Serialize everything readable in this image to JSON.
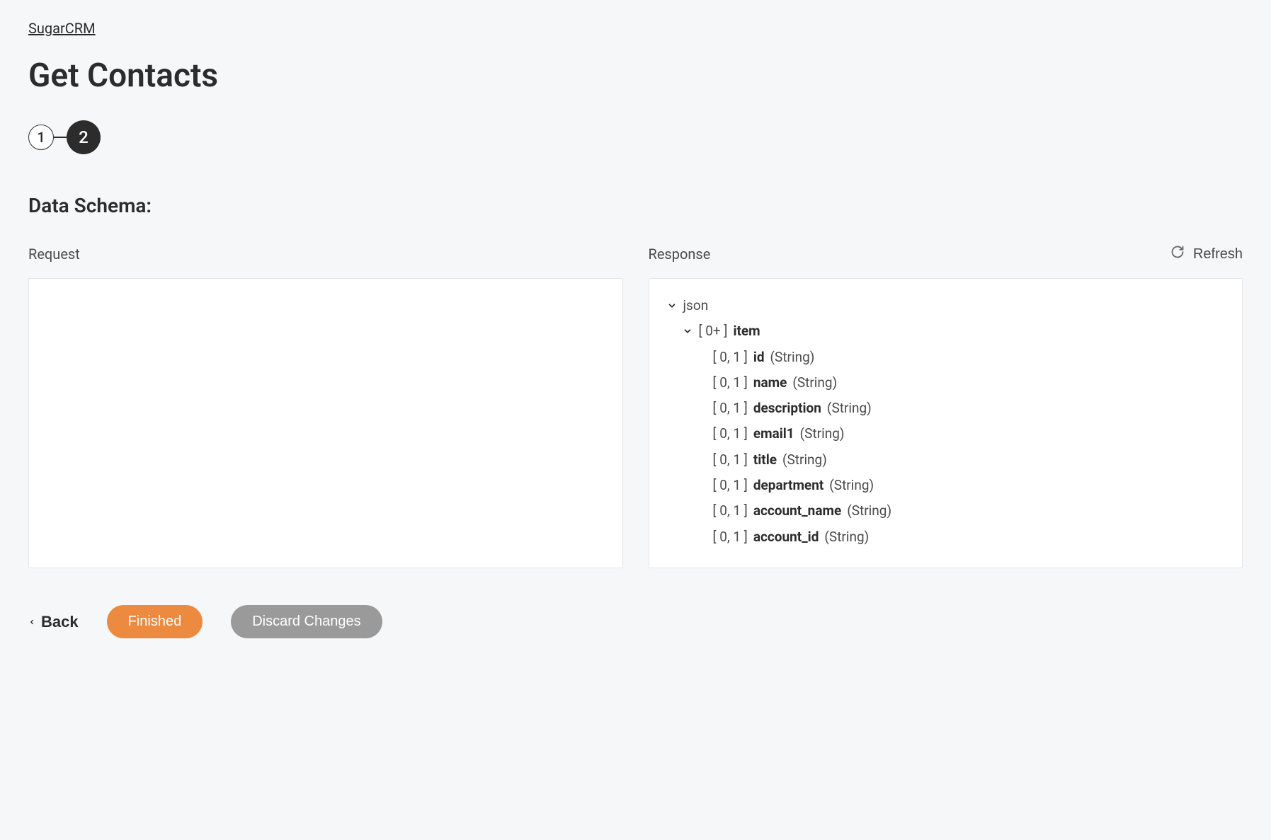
{
  "breadcrumb": {
    "label": "SugarCRM"
  },
  "title": "Get Contacts",
  "stepper": {
    "steps": [
      {
        "num": "1",
        "active": false
      },
      {
        "num": "2",
        "active": true
      }
    ]
  },
  "section_title": "Data Schema:",
  "request": {
    "label": "Request"
  },
  "response": {
    "label": "Response",
    "refresh_label": "Refresh",
    "tree": {
      "root_label": "json",
      "item_card": "[ 0+ ]",
      "item_label": "item",
      "field_card": "[ 0, 1 ]",
      "fields": [
        {
          "name": "id",
          "type": "(String)"
        },
        {
          "name": "name",
          "type": "(String)"
        },
        {
          "name": "description",
          "type": "(String)"
        },
        {
          "name": "email1",
          "type": "(String)"
        },
        {
          "name": "title",
          "type": "(String)"
        },
        {
          "name": "department",
          "type": "(String)"
        },
        {
          "name": "account_name",
          "type": "(String)"
        },
        {
          "name": "account_id",
          "type": "(String)"
        }
      ]
    }
  },
  "footer": {
    "back": "Back",
    "finished": "Finished",
    "discard": "Discard Changes"
  }
}
